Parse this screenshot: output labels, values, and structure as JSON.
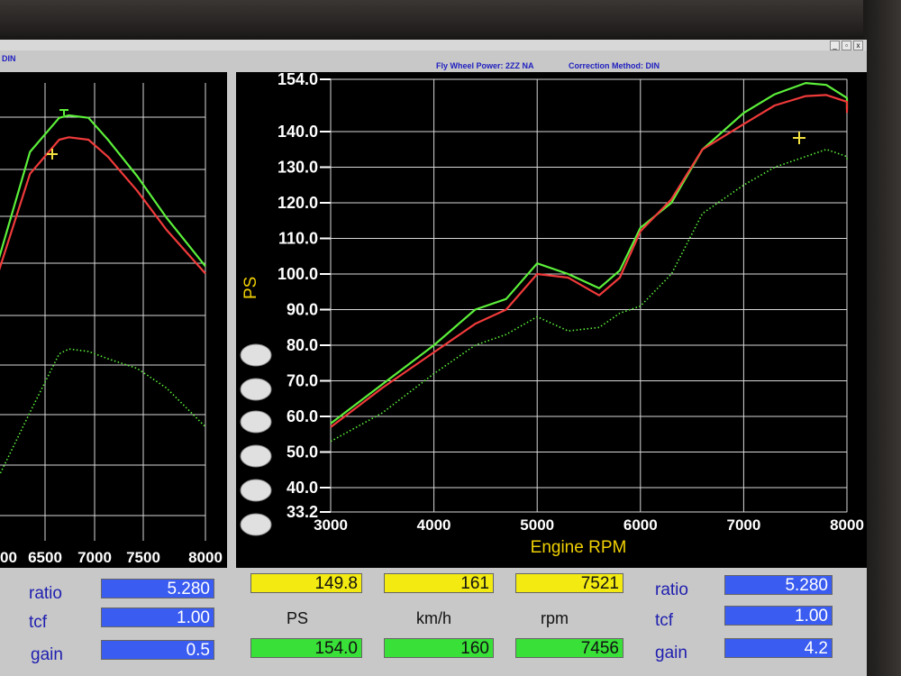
{
  "window": {
    "header_left": "DIN",
    "header_power": "Fly Wheel Power: 2ZZ NA",
    "header_correction": "Correction Method: DIN"
  },
  "left_chart": {
    "x_ticks": [
      "00",
      "6500",
      "7000",
      "7500",
      "8000"
    ],
    "ratio_label": "ratio",
    "ratio_value": "5.280",
    "tcf_label": "tcf",
    "tcf_value": "1.00",
    "gain_label": "gain",
    "gain_value": "0.5"
  },
  "right_chart": {
    "xlabel": "Engine RPM",
    "ylabel": "PS",
    "y_ticks": [
      "154.0",
      "140.0",
      "130.0",
      "120.0",
      "110.0",
      "100.0",
      "90.0",
      "80.0",
      "70.0",
      "60.0",
      "50.0",
      "40.0",
      "33.2"
    ],
    "x_ticks": [
      "3000",
      "4000",
      "5000",
      "6000",
      "7000",
      "8000"
    ]
  },
  "readouts": {
    "yellow": [
      "149.8",
      "161",
      "7521"
    ],
    "green": [
      "154.0",
      "160",
      "7456"
    ],
    "units": [
      "PS",
      "km/h",
      "rpm"
    ],
    "ratio_label": "ratio",
    "ratio_value": "5.280",
    "tcf_label": "tcf",
    "tcf_value": "1.00",
    "gain_label": "gain",
    "gain_value": "4.2"
  },
  "colors": {
    "green_series": "#5cf03a",
    "red_series": "#f03a3a",
    "cursor": "#f0e040",
    "ylabel_color": "#f0d000",
    "grid": "#d8d8d8"
  },
  "chart_data": {
    "type": "line",
    "xlabel": "Engine RPM",
    "ylabel": "PS",
    "xlim": [
      3000,
      8000
    ],
    "ylim": [
      33.2,
      154.0
    ],
    "x": [
      3000,
      3500,
      4000,
      4400,
      4700,
      5000,
      5300,
      5600,
      5800,
      6000,
      6300,
      6600,
      7000,
      7300,
      7600,
      7800,
      8000,
      8200
    ],
    "series": [
      {
        "name": "",
        "color": "#5cf03a",
        "line": "solid",
        "values": [
          58,
          69,
          80,
          90,
          93,
          103,
          100,
          96,
          101,
          113,
          120,
          135,
          145,
          150,
          153,
          152.5,
          149,
          146
        ]
      },
      {
        "name": "",
        "color": "#f03a3a",
        "line": "solid",
        "values": [
          57,
          68,
          78,
          86,
          90,
          100,
          99,
          94,
          99,
          112,
          121,
          135,
          142,
          147,
          149.5,
          149.8,
          148,
          145
        ]
      },
      {
        "name": "",
        "color": "#5cf03a",
        "line": "dotted",
        "values": [
          53,
          61,
          72,
          80,
          83,
          88,
          84,
          85,
          89,
          91,
          100,
          117,
          125,
          130,
          133,
          135,
          133,
          132
        ]
      }
    ],
    "left_panel": {
      "x": [
        5800,
        6200,
        6500,
        6600,
        6800,
        7000,
        7300,
        7600,
        8000
      ],
      "series": [
        {
          "color": "#5cf03a",
          "line": "solid",
          "values": [
            0.3,
            0.85,
            0.99,
            1.0,
            0.99,
            0.9,
            0.75,
            0.58,
            0.38
          ]
        },
        {
          "color": "#f03a3a",
          "line": "solid",
          "values": [
            0.26,
            0.76,
            0.9,
            0.91,
            0.9,
            0.83,
            0.69,
            0.53,
            0.35
          ]
        },
        {
          "color": "#5cf03a",
          "line": "dotted",
          "values": [
            -0.55,
            -0.22,
            0.02,
            0.04,
            0.03,
            0.0,
            -0.04,
            -0.12,
            -0.28
          ]
        }
      ]
    }
  }
}
